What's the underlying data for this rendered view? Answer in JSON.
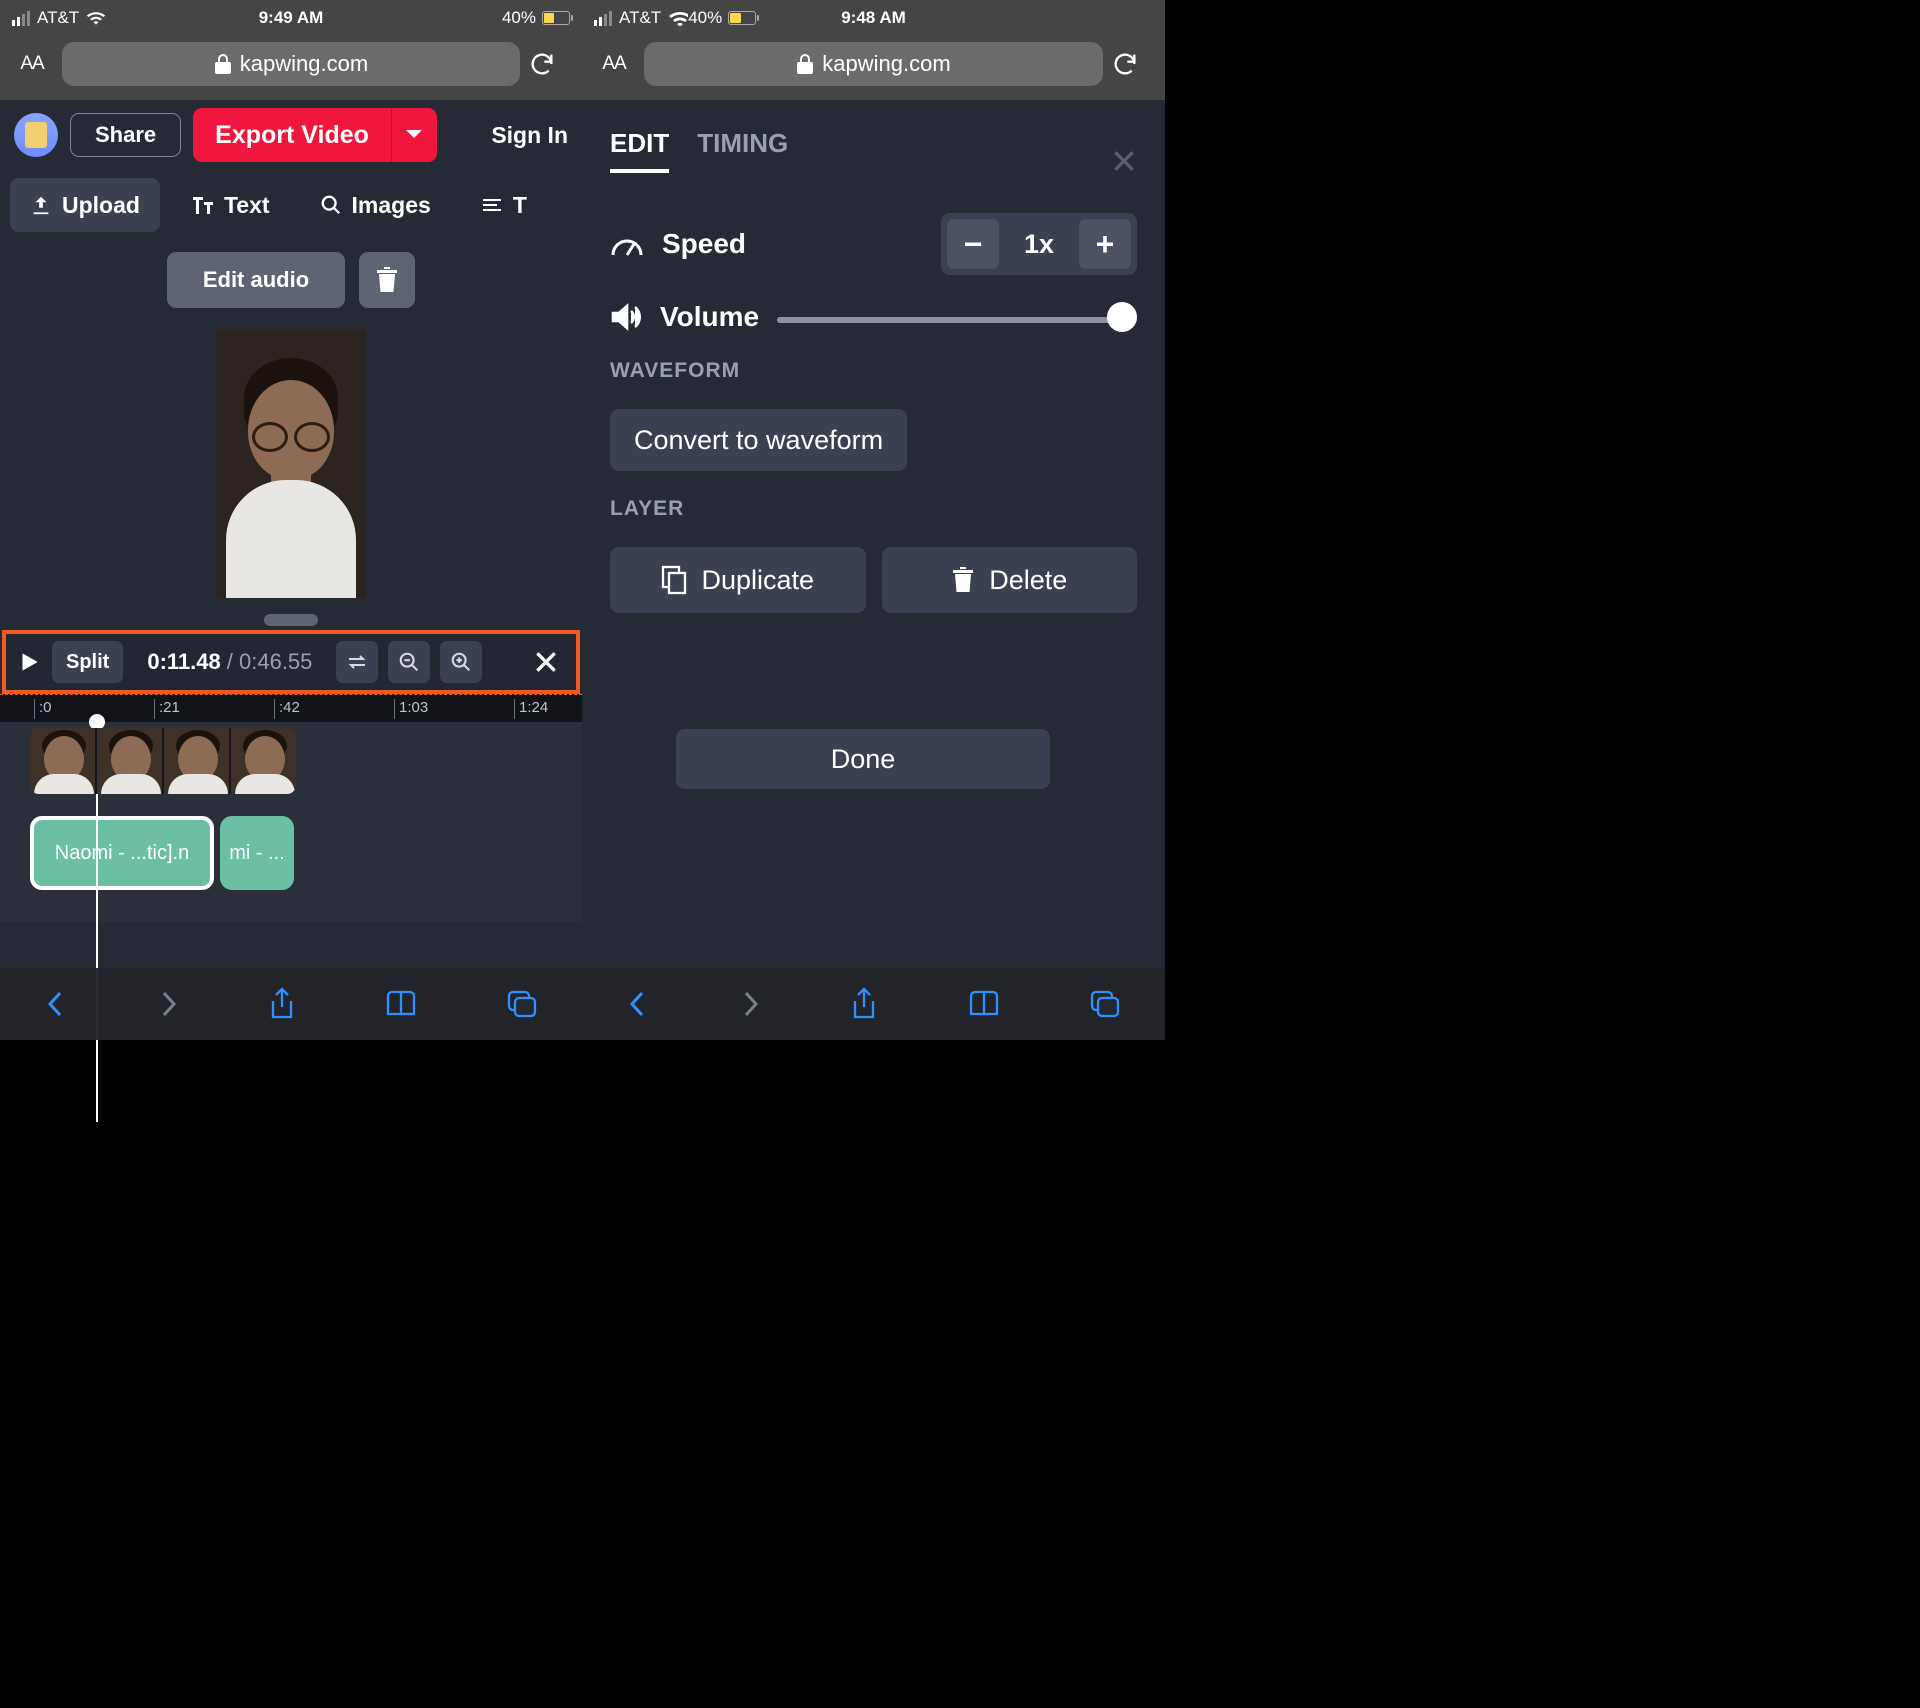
{
  "left": {
    "status": {
      "carrier": "AT&T",
      "time": "9:49 AM",
      "battery_pct": "40%"
    },
    "url": "kapwing.com",
    "aa": "AA",
    "header": {
      "share": "Share",
      "export": "Export Video",
      "signin": "Sign In"
    },
    "tabs": {
      "upload": "Upload",
      "text": "Text",
      "images": "Images",
      "more": "T"
    },
    "edit_audio": "Edit audio",
    "controls": {
      "split": "Split",
      "current": "0:11.48",
      "sep": "/",
      "total": "0:46.55"
    },
    "ruler": {
      "t0": ":0",
      "t1": ":21",
      "t2": ":42",
      "t3": "1:03",
      "t4": "1:24"
    },
    "clip1": "Naomi - ...tic].n",
    "clip2": "mi - ..."
  },
  "right": {
    "status": {
      "carrier": "AT&T",
      "time": "9:48 AM",
      "battery_pct": "40%"
    },
    "url": "kapwing.com",
    "aa": "AA",
    "tabs": {
      "edit": "EDIT",
      "timing": "TIMING"
    },
    "speed_label": "Speed",
    "speed_value": "1x",
    "volume_label": "Volume",
    "waveform_label": "WAVEFORM",
    "convert": "Convert to waveform",
    "layer_label": "LAYER",
    "duplicate": "Duplicate",
    "delete": "Delete",
    "done": "Done"
  }
}
